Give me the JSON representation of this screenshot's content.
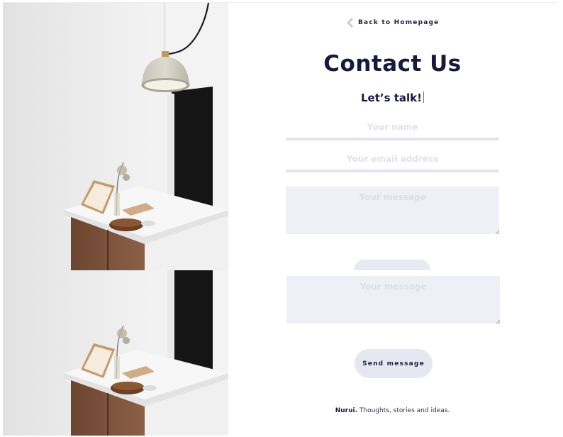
{
  "back_link": {
    "label": "Back to Homepage",
    "icon": "chevron-left-icon"
  },
  "page": {
    "title": "Contact Us",
    "subtitle": "Let’s talk!"
  },
  "form": {
    "name_placeholder": "Your name",
    "email_placeholder": "Your email address",
    "message_placeholder": "Your message",
    "send_label": "Send message"
  },
  "footer": {
    "brand": "Nurui.",
    "tagline": "Thoughts, stories and ideas."
  },
  "colors": {
    "ink": "#171a3e",
    "field_border": "#e2e3ec",
    "textarea_bg": "#eff0f5",
    "button_bg": "#e6e7f0",
    "placeholder": "#e0e2ec"
  }
}
